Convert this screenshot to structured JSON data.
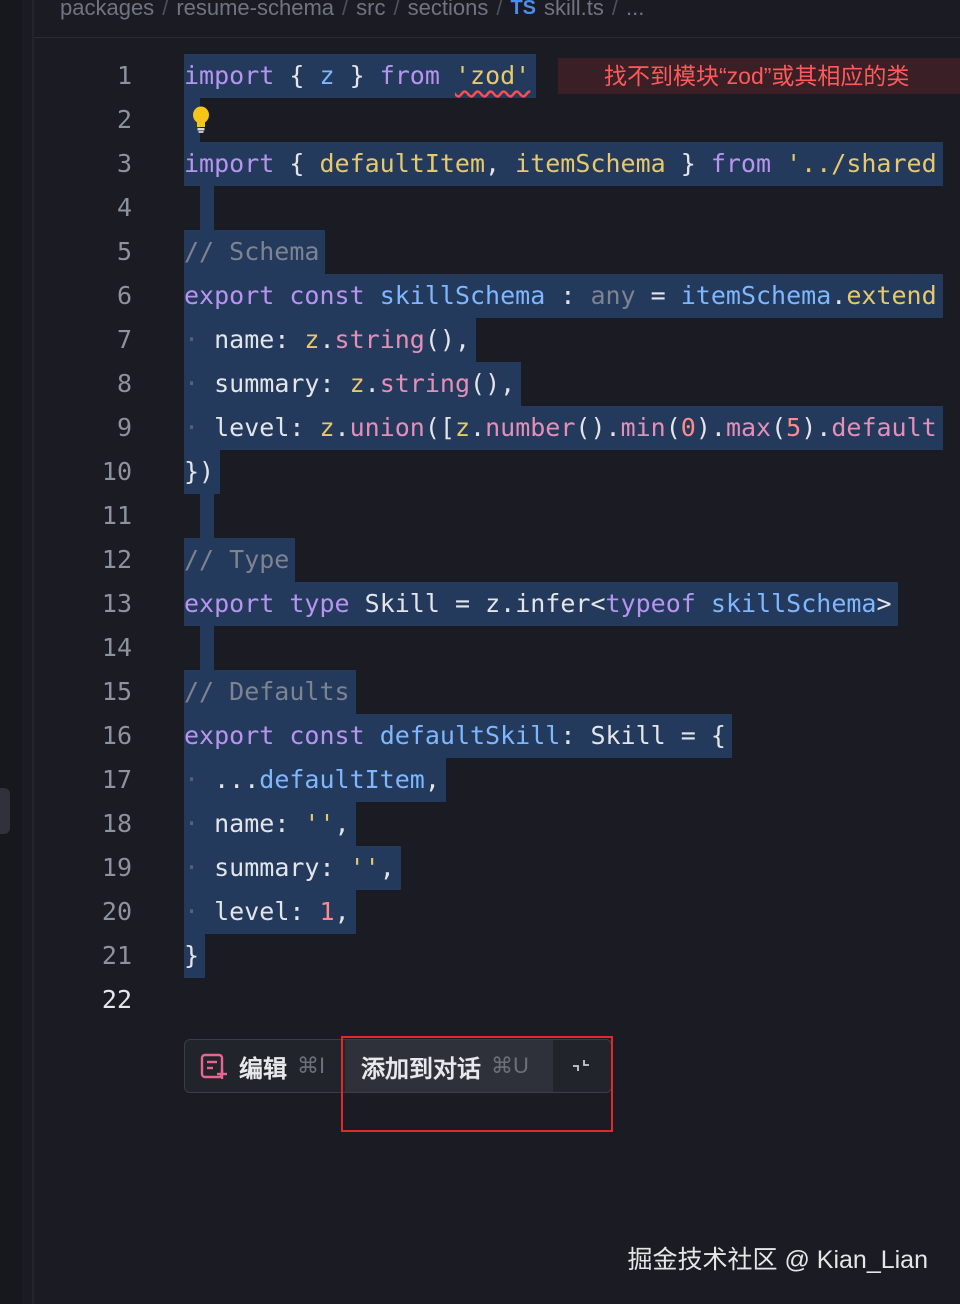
{
  "breadcrumb": {
    "segments": [
      "packages",
      "resume-schema",
      "src",
      "sections"
    ],
    "file_badge": "TS",
    "file_name": "skill.ts",
    "more": "..."
  },
  "editor": {
    "line_numbers": [
      "1",
      "2",
      "3",
      "4",
      "5",
      "6",
      "7",
      "8",
      "9",
      "10",
      "11",
      "12",
      "13",
      "14",
      "15",
      "16",
      "17",
      "18",
      "19",
      "20",
      "21",
      "22"
    ],
    "active_line": "22",
    "diagnostic_message": "找不到模块“zod”或其相应的类",
    "lightbulb_icon": "lightbulb-icon",
    "lines": {
      "l1": [
        "import",
        " { ",
        "z",
        " } ",
        "from",
        " ",
        "'zod'"
      ],
      "l3": [
        "import",
        " { ",
        "defaultItem",
        ", ",
        "itemSchema",
        " } ",
        "from",
        " ",
        "'../shared"
      ],
      "l5": "// Schema",
      "l6": [
        "export",
        " ",
        "const",
        " ",
        "skillSchema",
        " : ",
        "any",
        " = ",
        "itemSchema",
        ".",
        "extend"
      ],
      "l7": [
        "name: ",
        "z",
        ".",
        "string",
        "(),"
      ],
      "l8": [
        "summary: ",
        "z",
        ".",
        "string",
        "(),"
      ],
      "l9": [
        "level: ",
        "z",
        ".",
        "union",
        "([",
        "z",
        ".",
        "number",
        "().",
        "min",
        "(",
        "0",
        ").",
        "max",
        "(",
        "5",
        ").",
        "default"
      ],
      "l10": "})",
      "l12": "// Type",
      "l13": [
        "export",
        " ",
        "type",
        " ",
        "Skill",
        " = ",
        "z",
        ".",
        "infer",
        "<",
        "typeof",
        " ",
        "skillSchema",
        ">"
      ],
      "l15": "// Defaults",
      "l16": [
        "export",
        " ",
        "const",
        " ",
        "defaultSkill",
        ": ",
        "Skill",
        " = {"
      ],
      "l17": [
        "...",
        "defaultItem",
        ","
      ],
      "l18": [
        "name: ",
        "''",
        ","
      ],
      "l19": [
        "summary: ",
        "''",
        ","
      ],
      "l20": [
        "level: ",
        "1",
        ","
      ],
      "l21": "}"
    }
  },
  "toolbar": {
    "edit_label": "编辑",
    "edit_shortcut": "⌘I",
    "add_label": "添加到对话",
    "add_shortcut": "⌘U",
    "collapse_icon": "collapse-icon",
    "edit_icon": "edit-note-icon"
  },
  "colors": {
    "selection": "#243a5c",
    "error": "#ff5a5a",
    "highlight_box": "#e0282d"
  },
  "watermark": "掘金技术社区 @ Kian_Lian"
}
